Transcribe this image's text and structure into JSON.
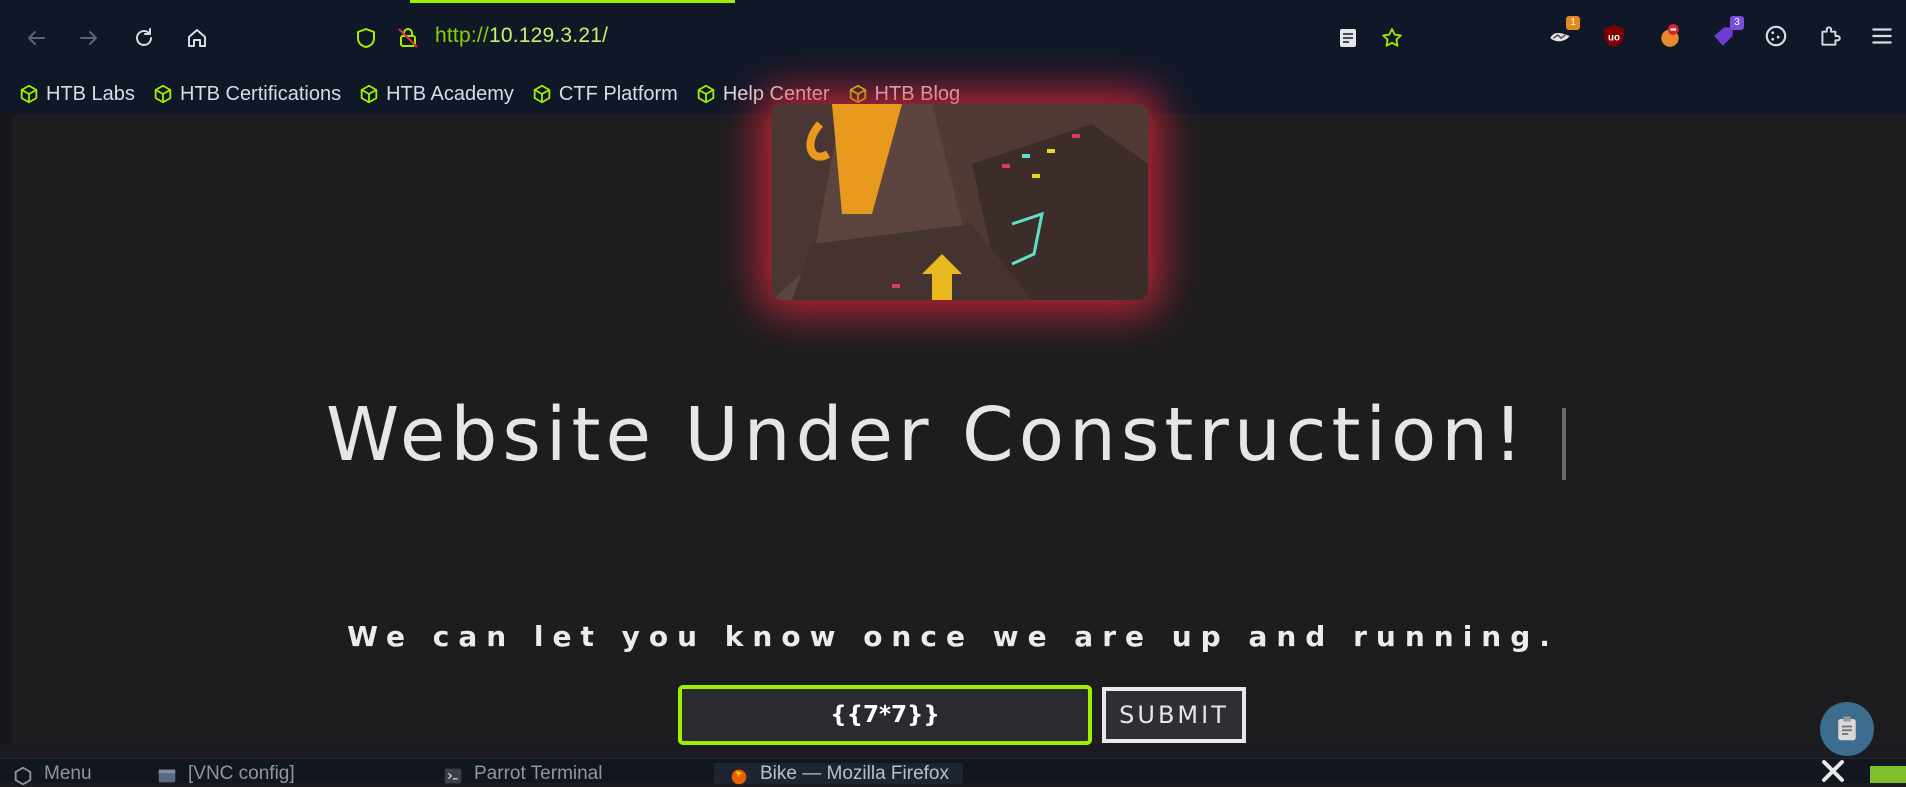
{
  "browser": {
    "url_protocol": "http://",
    "url_host": "10.129.3.21/",
    "extensions": [
      {
        "name": "wappalyzer",
        "badge": "1"
      },
      {
        "name": "ublock",
        "badge": ""
      },
      {
        "name": "foxyproxy",
        "badge": ""
      },
      {
        "name": "tag-extension",
        "badge": "3"
      },
      {
        "name": "cookie-editor",
        "badge": ""
      }
    ]
  },
  "bookmarks": [
    {
      "label": "HTB Labs"
    },
    {
      "label": "HTB Certifications"
    },
    {
      "label": "HTB Academy"
    },
    {
      "label": "CTF Platform"
    },
    {
      "label": "Help Center"
    },
    {
      "label": "HTB Blog"
    }
  ],
  "page": {
    "headline": "Website Under Construction!",
    "subtitle": "We can let you know once we are up and running.",
    "email_value": "{{7*7}}",
    "submit_label": "SUBMIT"
  },
  "taskbar": {
    "items": [
      {
        "label": "Menu"
      },
      {
        "label": "[VNC config]"
      },
      {
        "label": "Parrot Terminal"
      },
      {
        "label": "Bike — Mozilla Firefox"
      }
    ]
  },
  "colors": {
    "accent": "#9fef00",
    "glow": "#e6283c",
    "page_bg": "#1d1d20",
    "toolbar_bg": "#101827"
  }
}
